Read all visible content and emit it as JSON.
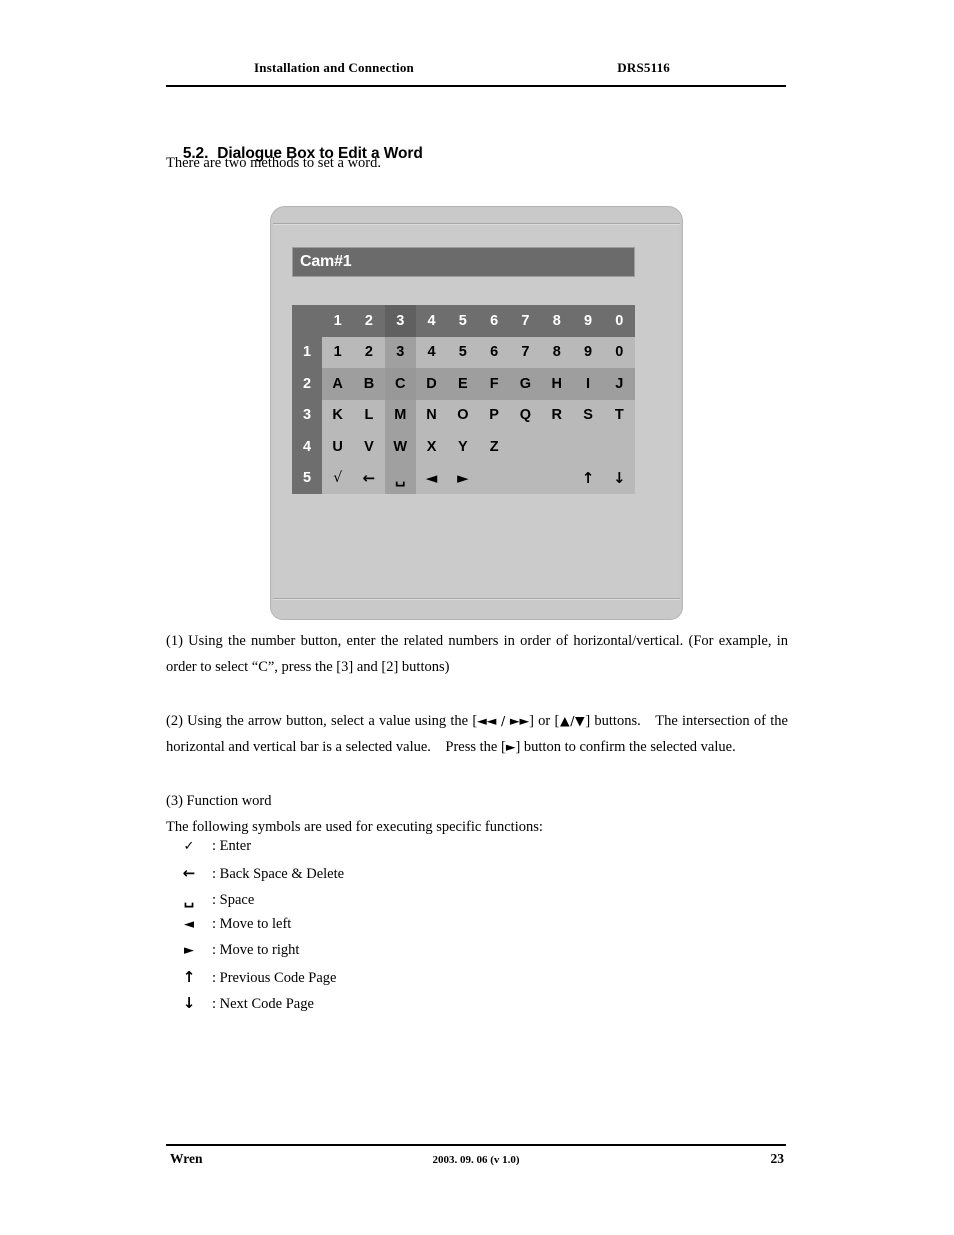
{
  "header": {
    "left": "Installation and Connection",
    "right": "DRS5116"
  },
  "section": {
    "number": "5.2.",
    "title": "Dialogue Box to Edit a Word",
    "intro": "There are two methods to set a word."
  },
  "dialog": {
    "title": "Cam#1",
    "column_headers": [
      "1",
      "2",
      "3",
      "4",
      "5",
      "6",
      "7",
      "8",
      "9",
      "0"
    ],
    "row_headers": [
      "1",
      "2",
      "3",
      "4",
      "5"
    ],
    "highlight": {
      "column_index": 2,
      "row_index": 1,
      "selected_value": "C"
    },
    "rows": [
      [
        "1",
        "2",
        "3",
        "4",
        "5",
        "6",
        "7",
        "8",
        "9",
        "0"
      ],
      [
        "A",
        "B",
        "C",
        "D",
        "E",
        "F",
        "G",
        "H",
        "I",
        "J"
      ],
      [
        "K",
        "L",
        "M",
        "N",
        "O",
        "P",
        "Q",
        "R",
        "S",
        "T"
      ],
      [
        "U",
        "V",
        "W",
        "X",
        "Y",
        "Z",
        "",
        "",
        "",
        ""
      ],
      [
        "√",
        "←",
        "␣",
        "◄",
        "►",
        "",
        "",
        "",
        "↑",
        "↓"
      ]
    ],
    "colors": {
      "shell": "#c9c9c9",
      "title_bar": "#6b6b6b",
      "header_cell": "#6e6e6e",
      "body_cell": "#b9b9b9",
      "highlight_cell": "#9e9e9e",
      "cross_cell": "#989898"
    }
  },
  "paragraphs": {
    "p1": "(1) Using the number button, enter the related numbers in order of horizontal/vertical. (For example, in order to select “C”, press the [3] and [2] buttons)",
    "p2_a": "(2) Using the arrow button, select a value using the [",
    "p2_arrows1": "◄◄ / ►►",
    "p2_b": "] or [",
    "p2_arrows2": "▲/▼",
    "p2_c": "] buttons. The intersection of the horizontal and vertical bar is a selected value. Press the [",
    "p2_arrows3": "►",
    "p2_d": "] button to confirm the selected value.",
    "p3": "(3) Function word",
    "p4": "The following symbols are used for executing specific functions:"
  },
  "legend": [
    {
      "symbol": "✓",
      "label": ": Enter"
    },
    {
      "symbol": "←",
      "label": ": Back Space & Delete"
    },
    {
      "symbol": "␣",
      "label": ": Space"
    },
    {
      "symbol": "◄",
      "label": ": Move to left"
    },
    {
      "symbol": "►",
      "label": ": Move to right"
    },
    {
      "symbol": "↑",
      "label": ": Previous Code Page"
    },
    {
      "symbol": "↓",
      "label": ": Next Code Page"
    }
  ],
  "footer": {
    "left": "Wren",
    "center": "2003. 09. 06 (v 1.0)",
    "right": "23"
  }
}
